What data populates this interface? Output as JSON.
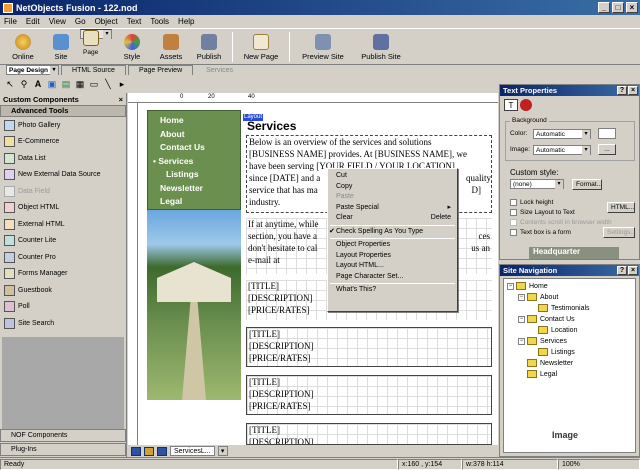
{
  "window": {
    "title": "NetObjects Fusion - 122.nod"
  },
  "menu": [
    "File",
    "Edit",
    "View",
    "Go",
    "Object",
    "Text",
    "Tools",
    "Help"
  ],
  "toolbar": [
    "Online",
    "Site",
    "Page",
    "Style",
    "Assets",
    "Publish",
    "New Page",
    "Preview Site",
    "Publish Site"
  ],
  "view_tabs": [
    "Page Design",
    "HTML Source",
    "Page Preview",
    "Services"
  ],
  "left_panel": {
    "title": "Custom Components",
    "section": "Advanced Tools",
    "items": [
      {
        "label": "Photo Gallery",
        "enabled": true
      },
      {
        "label": "E-Commerce",
        "enabled": true
      },
      {
        "label": "Data List",
        "enabled": true
      },
      {
        "label": "New External Data Source",
        "enabled": true
      },
      {
        "label": "Data Field",
        "enabled": false
      },
      {
        "label": "Object HTML",
        "enabled": true
      },
      {
        "label": "External HTML",
        "enabled": true
      },
      {
        "label": "Counter Lite",
        "enabled": true
      },
      {
        "label": "Counter Pro",
        "enabled": true
      },
      {
        "label": "Forms Manager",
        "enabled": true
      },
      {
        "label": "Guestbook",
        "enabled": true
      },
      {
        "label": "Poll",
        "enabled": true
      },
      {
        "label": "Site Search",
        "enabled": true
      }
    ],
    "bottom_sections": [
      "NOF Components",
      "Plug-Ins"
    ]
  },
  "page": {
    "layout_label": "Layout",
    "heading": "Services",
    "nav": [
      "Home",
      "About",
      "Contact Us",
      "Services",
      "Listings",
      "Newsletter",
      "Legal"
    ],
    "intro_lines": [
      "Below is an overview of the services and solutions",
      "[BUSINESS NAME] provides. At [BUSINESS NAME], we",
      "have been serving [YOUR FIELD / YOUR LOCATION]",
      "since [DATE] and a",
      "service that has ma",
      "industry."
    ],
    "intro_right": [
      "quality",
      "D]"
    ],
    "para2_lines": [
      "If at anytime, while",
      "section, you have a",
      "don't hesitate to cal",
      "e-mail at"
    ],
    "para2_right": [
      "ces",
      "us an"
    ],
    "listing": {
      "title": "[TITLE]",
      "description": "[DESCRIPTION]",
      "price": "[PRICE/RATES]"
    },
    "bottom_tab": "ServicesL..."
  },
  "context_menu": {
    "items": [
      {
        "label": "Cut",
        "enabled": true
      },
      {
        "label": "Copy",
        "enabled": true
      },
      {
        "label": "Paste",
        "enabled": false
      },
      {
        "label": "Paste Special",
        "enabled": true,
        "submenu": true
      },
      {
        "label": "Clear",
        "enabled": true,
        "shortcut": "Delete"
      },
      {
        "sep": true
      },
      {
        "label": "Check Spelling As You Type",
        "enabled": true,
        "checked": true
      },
      {
        "sep": true
      },
      {
        "label": "Object Properties",
        "enabled": true
      },
      {
        "label": "Layout Properties",
        "enabled": true
      },
      {
        "label": "Layout HTML...",
        "enabled": true
      },
      {
        "label": "Page Character Set...",
        "enabled": true
      },
      {
        "sep": true
      },
      {
        "label": "What's This?",
        "enabled": true
      }
    ]
  },
  "text_properties": {
    "title": "Text Properties",
    "background_label": "Background",
    "color_label": "Color:",
    "color_value": "Automatic",
    "image_label": "Image:",
    "image_value": "Automatic",
    "image_btn": "...",
    "custom_style_label": "Custom style:",
    "custom_style_value": "(none)",
    "format_btn": "Format...",
    "lock_height": "Lock height",
    "size_layout": "Size Layout to Text",
    "contents_scroll": "Contents scroll in browser width",
    "text_box_form": "Text box is a form",
    "html_btn": "HTML...",
    "settings_btn": "Settings...",
    "peek_label": "Headquarter"
  },
  "site_navigation": {
    "title": "Site Navigation",
    "nodes": [
      "Home",
      "About",
      "Testimonials",
      "Contact Us",
      "Location",
      "Services",
      "Listings",
      "Newsletter",
      "Legal"
    ],
    "peek_label": "Image"
  },
  "status": {
    "left": "Ready",
    "coords": "x:160 , y:154",
    "size": "w:378 h:114",
    "zoom": "100%"
  },
  "colors": {
    "nav_green": "#6b8f4f",
    "title_blue": "#0a246a",
    "layout_blue": "#2a4bd8",
    "folder": "#f2d64a"
  }
}
